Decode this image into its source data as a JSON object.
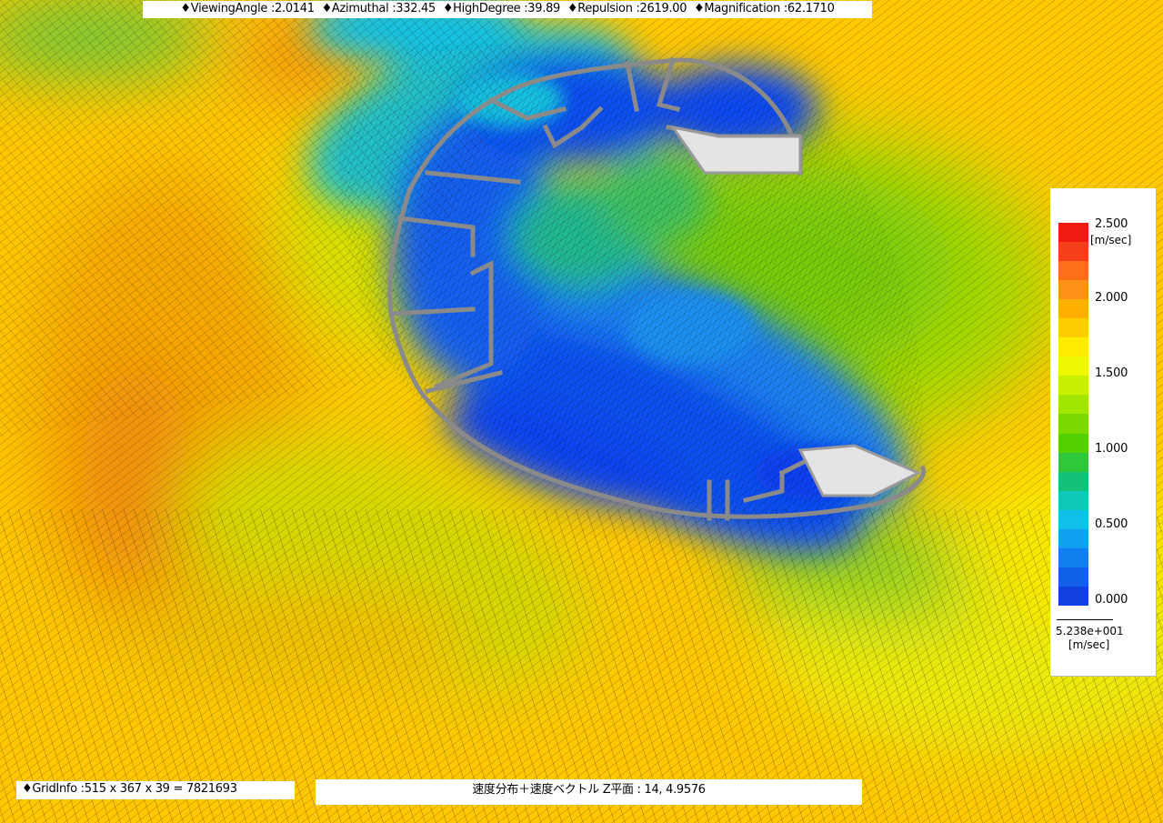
{
  "header": {
    "viewing_angle": "♦ViewingAngle :2.0141",
    "azimuthal": "♦Azimuthal :332.45",
    "high_degree": "♦HighDegree :39.89",
    "repulsion": "♦Repulsion :2619.00",
    "magnification": "♦Magnification :62.1710"
  },
  "footer": {
    "grid_info": "♦GridInfo :515 x 367 x 39 = 7821693",
    "plane_caption": "速度分布＋速度ベクトル Z平面 : 14,  4.9576"
  },
  "legend": {
    "max_label": "2.500",
    "unit": "[m/sec]",
    "ticks": [
      "2.000",
      "1.500",
      "1.000",
      "0.500",
      "0.000"
    ],
    "reference_value": "5.238e+001",
    "reference_unit": "[m/sec]",
    "colors": [
      "#f01a10",
      "#f5401a",
      "#ff6e18",
      "#ff9018",
      "#ffb000",
      "#ffce00",
      "#ffec00",
      "#eef800",
      "#c8f000",
      "#a0e600",
      "#7ada00",
      "#52d000",
      "#2ec83a",
      "#14c07a",
      "#10c8b8",
      "#10c0e8",
      "#10a0f0",
      "#1080f0",
      "#1060e8",
      "#1040e0"
    ]
  },
  "colors": {
    "field_yellow": "#ffd000",
    "field_orange": "#f5a000",
    "field_green": "#70d018",
    "field_blue": "#1040f0",
    "structure_gray": "#8a8a8a",
    "structure_light": "#e4e4e4"
  }
}
